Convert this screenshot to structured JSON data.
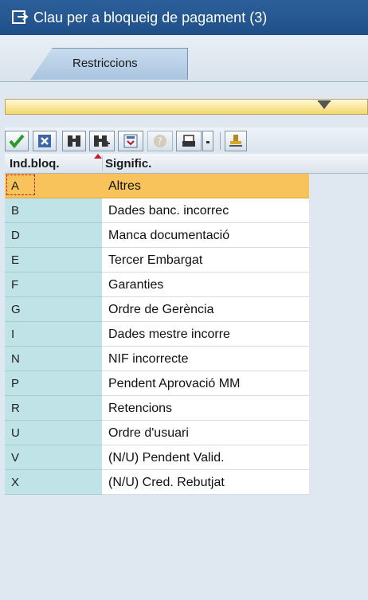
{
  "window": {
    "title": "Clau per a bloqueig de pagament (3)"
  },
  "tabs": [
    {
      "label": "Restriccions"
    }
  ],
  "toolbar": {
    "buttons": [
      {
        "icon": "checkmark-icon"
      },
      {
        "icon": "cancel-icon"
      },
      {
        "icon": "find-icon"
      },
      {
        "icon": "find-next-icon"
      },
      {
        "icon": "select-icon"
      },
      {
        "icon": "help-icon"
      },
      {
        "icon": "print-icon"
      },
      {
        "icon": "dropdown-arrow-icon"
      },
      {
        "icon": "stamp-icon"
      }
    ]
  },
  "table": {
    "columns": [
      "Ind.bloq.",
      "Signific."
    ],
    "rows": [
      {
        "key": "A",
        "value": "Altres",
        "selected": true
      },
      {
        "key": "B",
        "value": "Dades banc. incorrec"
      },
      {
        "key": "D",
        "value": "Manca documentació"
      },
      {
        "key": "E",
        "value": "Tercer Embargat"
      },
      {
        "key": "F",
        "value": "Garanties"
      },
      {
        "key": "G",
        "value": "Ordre de Gerència"
      },
      {
        "key": "I",
        "value": "Dades mestre incorre"
      },
      {
        "key": "N",
        "value": "NIF incorrecte"
      },
      {
        "key": "P",
        "value": "Pendent Aprovació MM"
      },
      {
        "key": "R",
        "value": "Retencions"
      },
      {
        "key": "U",
        "value": "Ordre d'usuari"
      },
      {
        "key": "V",
        "value": "(N/U) Pendent Valid."
      },
      {
        "key": "X",
        "value": "(N/U) Cred. Rebutjat"
      }
    ]
  },
  "colors": {
    "title_bar": "#1f4f88",
    "key_column": "#bfe3e6",
    "selected_row": "#f8c35a"
  }
}
